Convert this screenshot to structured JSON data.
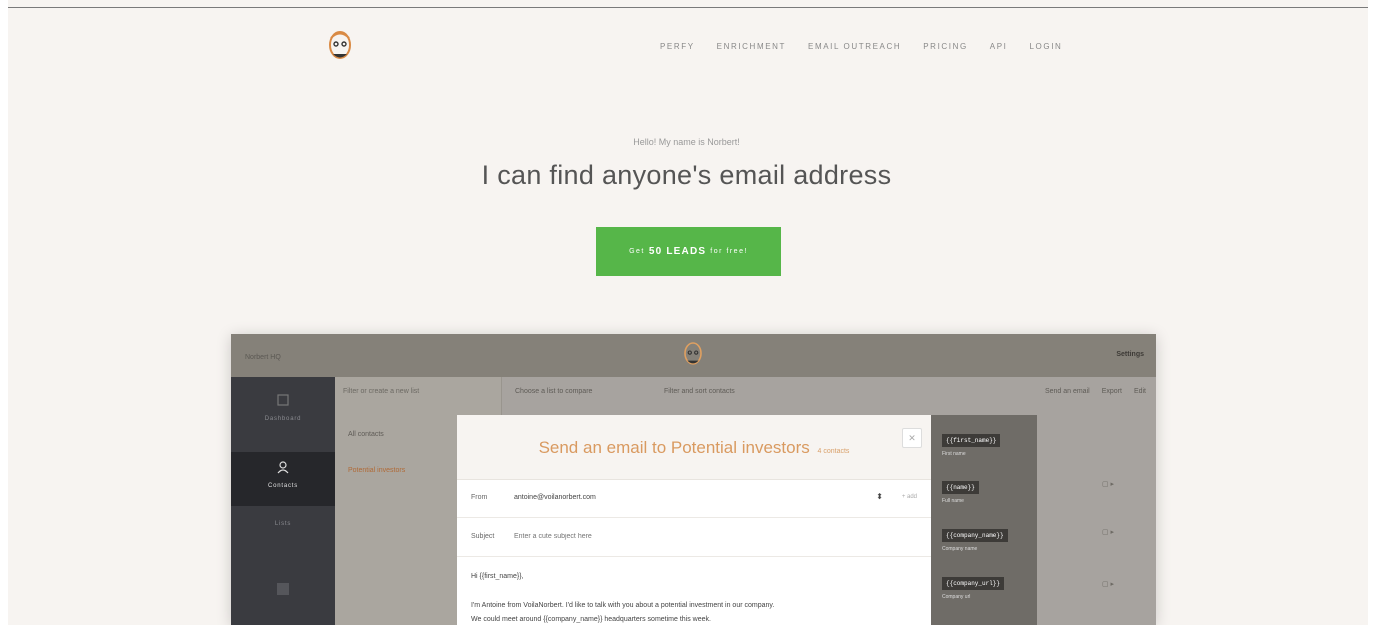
{
  "nav": {
    "items": [
      "Perfy",
      "Enrichment",
      "Email Outreach",
      "Pricing",
      "API",
      "Login"
    ]
  },
  "hero": {
    "subtitle": "Hello! My name is Norbert!",
    "title": "I can find anyone's email address",
    "cta_prefix": "Get",
    "cta_main": "50 LEADS",
    "cta_suffix": "for free!"
  },
  "app": {
    "account": "Norbert HQ",
    "settings": "Settings",
    "sidebar": [
      {
        "label": "Dashboard",
        "icon": "dashboard-icon"
      },
      {
        "label": "Contacts",
        "icon": "user-icon"
      },
      {
        "label": "Lists",
        "icon": "list-icon"
      }
    ],
    "lists": {
      "search_placeholder": "Filter or create a new list",
      "item_all": "All contacts",
      "item_active": "Potential investors"
    },
    "toolbar": {
      "left": "Choose a list to compare",
      "middle": "Filter and sort contacts",
      "right": [
        "Send an email",
        "Export",
        "Edit"
      ]
    },
    "modal": {
      "title": "Send an email to Potential investors",
      "count": "4 contacts",
      "from_label": "From",
      "from_value": "antoine@voilanorbert.com",
      "add_label": "+ add",
      "subject_label": "Subject",
      "subject_placeholder": "Enter a cute subject here",
      "greeting": "Hi {{first_name}},",
      "body_line1": "I'm Antoine from VoilaNorbert. I'd like to talk with you about a potential investment in our company.",
      "body_line2": "We could meet around {{company_name}} headquarters sometime this week."
    },
    "variables": [
      {
        "tag": "{{first_name}}",
        "label": "First name"
      },
      {
        "tag": "{{name}}",
        "label": "Full name"
      },
      {
        "tag": "{{company_name}}",
        "label": "Company name"
      },
      {
        "tag": "{{company_url}}",
        "label": "Company url"
      }
    ]
  }
}
